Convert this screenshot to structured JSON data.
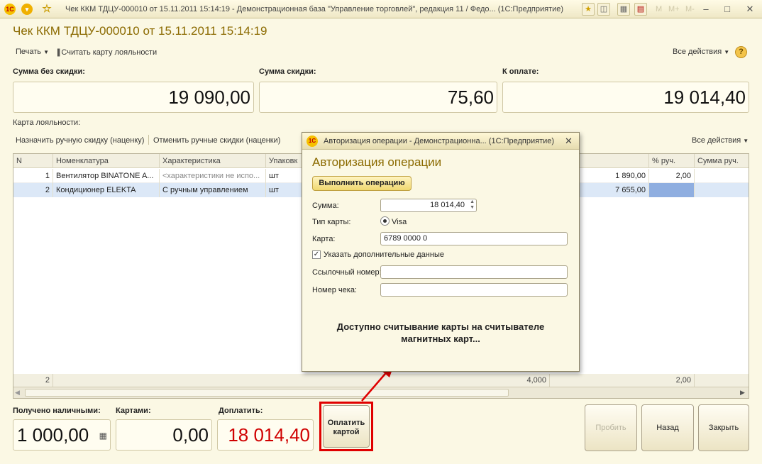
{
  "titlebar": {
    "title": "Чек ККМ ТДЦУ-000010 от 15.11.2011 15:14:19 - Демонстрационная база \"Управление торговлей\", редакция 11 / Федо... (1С:Предприятие)",
    "m_labels": [
      "M",
      "M+",
      "M-"
    ]
  },
  "document": {
    "title": "Чек ККМ ТДЦУ-000010 от 15.11.2011 15:14:19",
    "print_label": "Печать",
    "read_loyalty_label": "Считать карту лояльности",
    "all_actions_label": "Все действия",
    "help_label": "?"
  },
  "sums": {
    "no_discount_label": "Сумма без скидки:",
    "no_discount_value": "19 090,00",
    "discount_label": "Сумма скидки:",
    "discount_value": "75,60",
    "to_pay_label": "К оплате:",
    "to_pay_value": "19 014,40"
  },
  "loyalty_card_label": "Карта лояльности:",
  "table_toolbar": {
    "assign_discount": "Назначить ручную скидку (наценку)",
    "cancel_discounts": "Отменить ручные скидки (наценки)",
    "all_actions": "Все действия"
  },
  "table": {
    "columns": [
      "N",
      "Номенклатура",
      "Характеристика",
      "Упаковк",
      "% руч.",
      "Сумма руч."
    ],
    "rows": [
      {
        "n": "1",
        "item": "Вентилятор BINATONE A...",
        "char": "<характеристики не испо...",
        "pack": "шт",
        "amount": "1 890,00",
        "pct": "2,00",
        "sum": ""
      },
      {
        "n": "2",
        "item": "Кондиционер ELEKTA",
        "char": "С ручным управлением",
        "pack": "шт",
        "amount": "7 655,00",
        "pct": "",
        "sum": ""
      }
    ],
    "footer": {
      "count": "2",
      "qty": "4,000",
      "pct": "2,00"
    }
  },
  "dialog": {
    "title": "Авторизация операции - Демонстрационна... (1С:Предприятие)",
    "heading": "Авторизация операции",
    "execute_label": "Выполнить операцию",
    "sum_label": "Сумма:",
    "sum_value": "18 014,40",
    "card_type_label": "Тип карты:",
    "card_type_value": "Visa",
    "card_label": "Карта:",
    "card_value": "6789 0000 0",
    "extra_data_label": "Указать дополнительные данные",
    "ref_number_label": "Ссылочный номер:",
    "ref_number_value": "",
    "receipt_number_label": "Номер чека:",
    "receipt_number_value": "",
    "message": "Доступно считывание карты на считывателе магнитных карт..."
  },
  "bottom": {
    "cash_label": "Получено наличными:",
    "cash_value": "1 000,00",
    "cards_label": "Картами:",
    "cards_value": "0,00",
    "topay_label": "Доплатить:",
    "topay_value": "18 014,40",
    "pay_card_label": "Оплатить картой",
    "punch_label": "Пробить",
    "back_label": "Назад",
    "close_label": "Закрыть"
  },
  "colors": {
    "accent_red": "#d00000",
    "title_gold": "#8b6a00",
    "selected_row": "#dce8f7"
  }
}
